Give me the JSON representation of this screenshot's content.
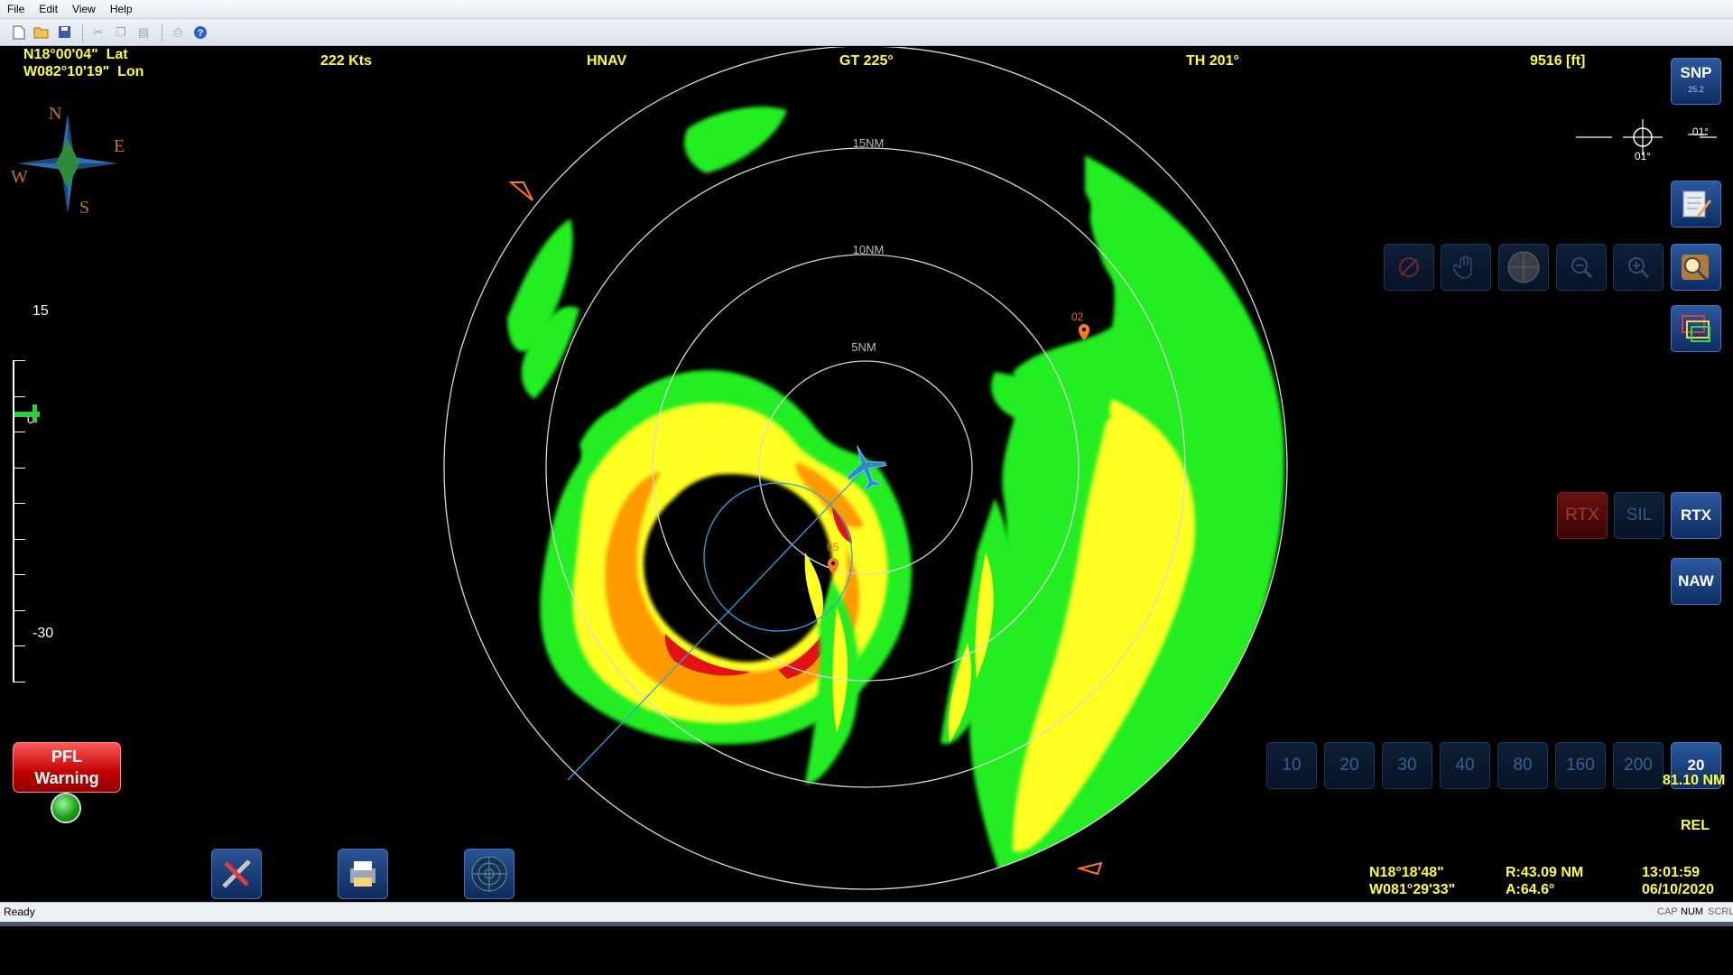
{
  "menu": [
    "File",
    "Edit",
    "View",
    "Help"
  ],
  "toolbar_icons": [
    "new-icon",
    "open-icon",
    "save-icon",
    "cut-icon",
    "copy-icon",
    "paste-icon",
    "print-icon",
    "help-icon"
  ],
  "hud": {
    "lat_value": "N18°00'04\"",
    "lat_label": "Lat",
    "lon_value": "W082°10'19\"",
    "lon_label": "Lon",
    "speed": "222 Kts",
    "nav_mode": "HNAV",
    "ground_track": "GT 225°",
    "true_heading": "TH 201°",
    "altitude": "9516 [ft]"
  },
  "compass": {
    "n": "N",
    "e": "E",
    "s": "S",
    "w": "W"
  },
  "tilt_scale": {
    "top": "15",
    "zero": "0",
    "bottom": "-30"
  },
  "pfl_warning": {
    "line1": "PFL",
    "line2": "Warning"
  },
  "radar": {
    "rings": [
      "5NM",
      "10NM",
      "15NM"
    ],
    "waypoints": [
      "02",
      "05"
    ]
  },
  "right_panel": {
    "snp": "SNP",
    "snp_sub": "25.2",
    "roll_left": "01°",
    "roll_right": "01°",
    "rtx_dim": "RTX",
    "sil": "SIL",
    "rtx": "RTX",
    "naw": "NAW",
    "ranges": [
      "10",
      "20",
      "30",
      "40",
      "80",
      "160",
      "200"
    ],
    "range_selected": "20",
    "range_nm": "81.10 NM",
    "rel": "REL"
  },
  "cursor": {
    "lat": "N18°18'48\"",
    "lon": "W081°29'33\"",
    "range": "R:43.09 NM",
    "azimuth": "A:64.6°",
    "time": "13:01:59",
    "date": "06/10/2020"
  },
  "status": {
    "left": "Ready",
    "indicators": [
      "CAP",
      "NUM",
      "SCRL"
    ]
  },
  "colors": {
    "hud_text": "#ffff33",
    "button_blue": "#2c5aa0",
    "weather_green": "#22ee22",
    "weather_yellow": "#ffff22",
    "weather_orange": "#ff9a00",
    "weather_red": "#e31212"
  }
}
